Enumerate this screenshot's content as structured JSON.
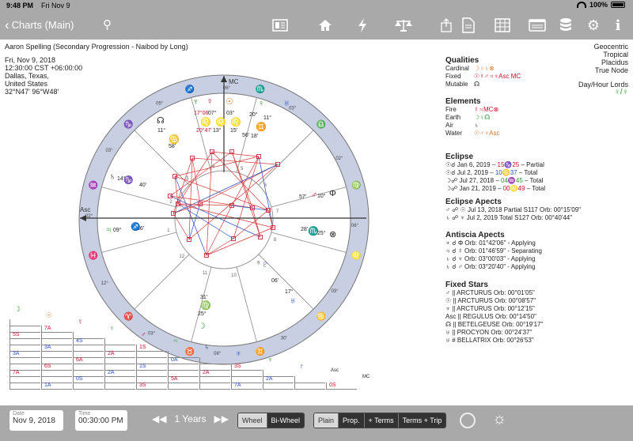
{
  "status": {
    "time": "9:48 PM",
    "day": "Fri Nov 9",
    "battery": "100%"
  },
  "nav": {
    "back_label": "Charts (Main)",
    "icons": [
      "search-icon",
      "list-card-icon",
      "home-icon",
      "lightning-icon",
      "scales-icon",
      "share-icon",
      "document-icon",
      "table-icon",
      "card-icon",
      "database-icon",
      "gear-icon",
      "info-icon"
    ]
  },
  "chart": {
    "name": "Aaron Spelling (Secondary Progression - Naibod by Long)",
    "date": "Fri, Nov 9, 2018",
    "time": "12:30:00 CST +06:00:00",
    "city": "Dallas, Texas,",
    "country": "United States",
    "coords": "32°N47' 96°W48'",
    "system": [
      "Geocentric",
      "Tropical",
      "Placidus",
      "True Node"
    ],
    "day_hour_label": "Day/Hour Lords",
    "day_hour_value": "♀/♀"
  },
  "qualities": {
    "title": "Qualities",
    "rows": [
      {
        "label": "Cardinal",
        "glyphs": "☽♀♄⊗"
      },
      {
        "label": "Fixed",
        "glyphs": "☉☿♂♃♆Asc MC"
      },
      {
        "label": "Mutable",
        "glyphs": "☊"
      }
    ]
  },
  "elements": {
    "title": "Elements",
    "rows": [
      {
        "label": "Fire",
        "glyphs": "☿♃MC⊗"
      },
      {
        "label": "Earth",
        "glyphs": "☽♀☊"
      },
      {
        "label": "Air",
        "glyphs": "♄"
      },
      {
        "label": "Water",
        "glyphs": "☉♂♆Asc"
      }
    ]
  },
  "eclipse": {
    "title": "Eclipse",
    "rows": [
      {
        "g": "☉☌",
        "date": "Jan 6, 2019 –",
        "pos": "15♑25",
        "kind": "– Partial",
        "c": "r"
      },
      {
        "g": "☉☌",
        "date": "Jul 2, 2019 –",
        "pos": "10♋37",
        "kind": "– Total",
        "c": "b"
      },
      {
        "g": "☽☍",
        "date": "Jul 27, 2018 –",
        "pos": "04♒45",
        "kind": "– Total",
        "c": "gr"
      },
      {
        "g": "☽☍",
        "date": "Jan 21, 2019 –",
        "pos": "00♌49",
        "kind": "– Total",
        "c": "r"
      }
    ]
  },
  "eclipse_aspects": {
    "title": "Eclipse Apects",
    "rows": [
      "♂ ☍ ☉ Jul 13, 2018 Partial S117 Orb: 00°15'09\"",
      "♄ ☍ ♆ Jul 2, 2019 Total S127 Orb: 00°40'44\""
    ]
  },
  "antiscia": {
    "title": "Antiscia Apects",
    "rows": [
      "♆ ☌ Φ Orb: 01°42'06\" - Applying",
      "♃ ☌ ☿ Orb: 01°46'59\" - Separating",
      "♄ ☌ ♆ Orb: 03°00'03\" - Applying",
      "♄ ☌ ♂ Orb: 03°20'40\" - Applying"
    ]
  },
  "fixed_stars": {
    "title": "Fixed Stars",
    "rows": [
      "♂ || ARCTURUS Orb: 00°01'05\"",
      "☉ || ARCTURUS Orb: 00°08'57\"",
      "♆ || ARCTURUS Orb: 00°12'15\"",
      "Asc || REGULUS Orb: 00°14'50\"",
      "☊ || BETELGEUSE Orb: 00°19'17\"",
      "♅ || PROCYON Orb: 00°24'37\"",
      "♅ # BELLATRIX Orb: 00°26'53\""
    ]
  },
  "wheel": {
    "sign_glyphs": [
      "♌",
      "♋",
      "♊",
      "♉",
      "♈",
      "♓",
      "♒",
      "♑",
      "♐",
      "♏",
      "♎",
      "♍"
    ],
    "cusp_labels": [
      "06°",
      "03°",
      "30'",
      "08°",
      "03°",
      "12°",
      "02°",
      "03°",
      "05°",
      "06°",
      "03°",
      "02°"
    ],
    "house_numbers": [
      "1",
      "2",
      "3",
      "4",
      "5",
      "6",
      "7",
      "8",
      "9",
      "10",
      "11",
      "12"
    ],
    "planet_labels": [
      {
        "t": "17°06'",
        "c": "r"
      },
      {
        "t": "07°",
        "c": "k"
      },
      {
        "t": "03°",
        "c": "k"
      },
      {
        "t": "20°",
        "c": "k"
      },
      {
        "t": "11°",
        "c": "k"
      },
      {
        "t": "20°47'",
        "c": "r"
      },
      {
        "t": "13°",
        "c": "k"
      },
      {
        "t": "15'",
        "c": "k"
      },
      {
        "t": "56'",
        "c": "k"
      },
      {
        "t": "18'",
        "c": "k"
      },
      {
        "t": "11°",
        "c": "k"
      },
      {
        "t": "58'",
        "c": "k"
      },
      {
        "t": "14°",
        "c": "k"
      },
      {
        "t": "40'",
        "c": "k"
      },
      {
        "t": "09°",
        "c": "k"
      },
      {
        "t": "36'",
        "c": "k"
      },
      {
        "t": "57'",
        "c": "k"
      },
      {
        "t": "10°",
        "c": "k"
      },
      {
        "t": "28'",
        "c": "k"
      },
      {
        "t": "25°",
        "c": "k"
      },
      {
        "t": "06'",
        "c": "k"
      },
      {
        "t": "17°",
        "c": "k"
      },
      {
        "t": "31'",
        "c": "k"
      },
      {
        "t": "25°",
        "c": "k"
      }
    ],
    "asc_label": "Asc",
    "mc_label": "MC"
  },
  "grid": {
    "planet_glyphs": [
      "☽",
      "☉",
      "☿",
      "♀",
      "♂",
      "♃",
      "♄",
      "♅",
      "♆",
      "♇",
      "Asc",
      "MC"
    ],
    "cells": [
      "7A",
      "5S",
      "4S",
      "3A",
      "1S",
      "3A",
      "2A",
      "6A",
      "0A",
      "6S",
      "1S",
      "3S",
      "7A",
      "2A",
      "2A",
      "0S",
      "5A",
      "2A",
      "1A",
      "3S",
      "7A",
      "0S",
      "5S",
      "4S",
      "6S",
      "2S",
      "0S",
      "3S",
      "0S",
      "0S",
      "0S",
      "2S"
    ]
  },
  "bottom": {
    "date_label": "Date",
    "date_value": "Nov 9, 2018",
    "time_label": "Time",
    "time_value": "00:30:00 PM",
    "years_label": "1 Years",
    "prev_icon": "rewind-icon",
    "next_icon": "fast-forward-icon",
    "wheel_tabs": [
      "Wheel",
      "Bi-Wheel"
    ],
    "view_tabs": [
      "Plain",
      "Prop.",
      "+ Terms",
      "Terms + Trip"
    ],
    "sun_icon": "sun-icon"
  },
  "colors": {
    "accent_orange": "#d9792a",
    "accent_red": "#c8102e",
    "accent_green": "#2c9d2c",
    "accent_blue": "#2750c9",
    "bar_gray": "#a9a9a9",
    "ring_fill": "#c9cfe3"
  }
}
